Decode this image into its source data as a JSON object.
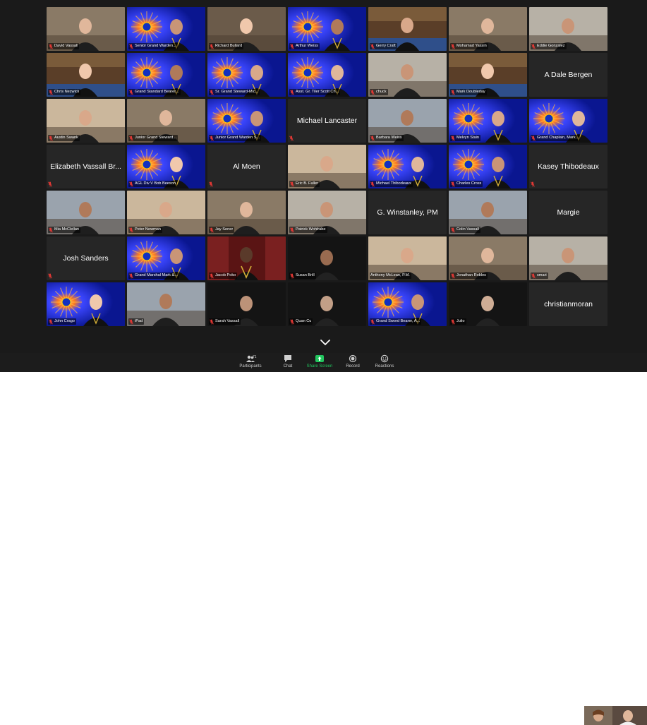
{
  "colors": {
    "background": "#1a1a1a",
    "tile": "#2b2b2b",
    "active_speaker_border": "#c6d63a",
    "share_screen_green": "#22c55e",
    "muted_mic_red": "#e53935",
    "masonic_blue": "#1a2fd0"
  },
  "participants": [
    {
      "name": "David Vassall",
      "video": "room",
      "muted": true
    },
    {
      "name": "Senior Grand Warden...",
      "video": "masonic",
      "muted": true
    },
    {
      "name": "Richard Bullard",
      "video": "room",
      "muted": true
    },
    {
      "name": "Arthur Weiss",
      "video": "masonic",
      "muted": true
    },
    {
      "name": "Gerry Craft",
      "video": "lodge",
      "muted": true
    },
    {
      "name": "Mohamad Yassin",
      "video": "room",
      "muted": true
    },
    {
      "name": "Eddie Gonzalez",
      "video": "room",
      "muted": true
    },
    {
      "name": "Chris Nezwick",
      "video": "lodge",
      "muted": true
    },
    {
      "name": "Grand Standard Bearer...",
      "video": "masonic",
      "muted": true
    },
    {
      "name": "Sr. Grand Steward-Mic...",
      "video": "masonic",
      "muted": true
    },
    {
      "name": "Asst. Gr. Tiler Scott Ch...",
      "video": "masonic",
      "muted": true
    },
    {
      "name": "chuck",
      "video": "room",
      "muted": true
    },
    {
      "name": "Mark Doubleday",
      "video": "lodge",
      "muted": true
    },
    {
      "name": "A Dale Bergen",
      "video": "none",
      "muted": false
    },
    {
      "name": "Austin Swank",
      "video": "room",
      "muted": true
    },
    {
      "name": "Junior Grand Steward...",
      "video": "room",
      "muted": true
    },
    {
      "name": "Junior Grand Warden S...",
      "video": "masonic",
      "muted": true
    },
    {
      "name": "Michael Lancaster",
      "video": "none",
      "muted": true
    },
    {
      "name": "Barbara Weiss",
      "video": "room",
      "muted": true
    },
    {
      "name": "Melvyn Stain",
      "video": "masonic",
      "muted": true
    },
    {
      "name": "Grand Chaplain, Mark...",
      "video": "masonic",
      "muted": true
    },
    {
      "name": "Elizabeth Vassall Br...",
      "video": "none",
      "muted": true
    },
    {
      "name": "AGL Div V Bob Beeson",
      "video": "masonic",
      "muted": true
    },
    {
      "name": "Al Moen",
      "video": "none",
      "muted": true
    },
    {
      "name": "Eric B. Fuller",
      "video": "room",
      "muted": true
    },
    {
      "name": "Michael Thibodeaux",
      "video": "masonic",
      "muted": true
    },
    {
      "name": "Charles Cross",
      "video": "masonic",
      "muted": true
    },
    {
      "name": "Kasey Thibodeaux",
      "video": "none",
      "muted": true
    },
    {
      "name": "Mia McClellan",
      "video": "room",
      "muted": true
    },
    {
      "name": "Peter Newman",
      "video": "room",
      "muted": true
    },
    {
      "name": "Jay Sener",
      "video": "room",
      "muted": true
    },
    {
      "name": "Patrick Wohlrabe",
      "video": "room",
      "muted": true
    },
    {
      "name": "G. Winstanley, PM",
      "video": "none",
      "muted": false
    },
    {
      "name": "Colin Vassall",
      "video": "room",
      "muted": true
    },
    {
      "name": "Margie",
      "video": "none",
      "muted": false
    },
    {
      "name": "Josh Sanders",
      "video": "none",
      "muted": true
    },
    {
      "name": "Grand Marshal Mark &...",
      "video": "masonic",
      "muted": true
    },
    {
      "name": "Jacob Poko",
      "video": "red",
      "muted": true
    },
    {
      "name": "Susan Brill",
      "video": "dark",
      "muted": true
    },
    {
      "name": "Anthony McLean, P.M.",
      "video": "room",
      "muted": false,
      "active": true
    },
    {
      "name": "Jonathan Robles",
      "video": "room",
      "muted": true
    },
    {
      "name": "smari",
      "video": "room",
      "muted": true
    },
    {
      "name": "John Crago",
      "video": "masonic",
      "muted": true
    },
    {
      "name": "iPad",
      "video": "room",
      "muted": true
    },
    {
      "name": "Sarah Vassall",
      "video": "dark",
      "muted": true
    },
    {
      "name": "Quan Cu",
      "video": "dark",
      "muted": true
    },
    {
      "name": "Grand Sword Bearer, A...",
      "video": "masonic",
      "muted": true
    },
    {
      "name": "Julio",
      "video": "dark",
      "muted": true
    },
    {
      "name": "christianmoran",
      "video": "none",
      "muted": false
    }
  ],
  "toolbar": {
    "participants_label": "Participants",
    "participants_count": "71",
    "chat_label": "Chat",
    "share_label": "Share Screen",
    "record_label": "Record",
    "reactions_label": "Reactions"
  }
}
